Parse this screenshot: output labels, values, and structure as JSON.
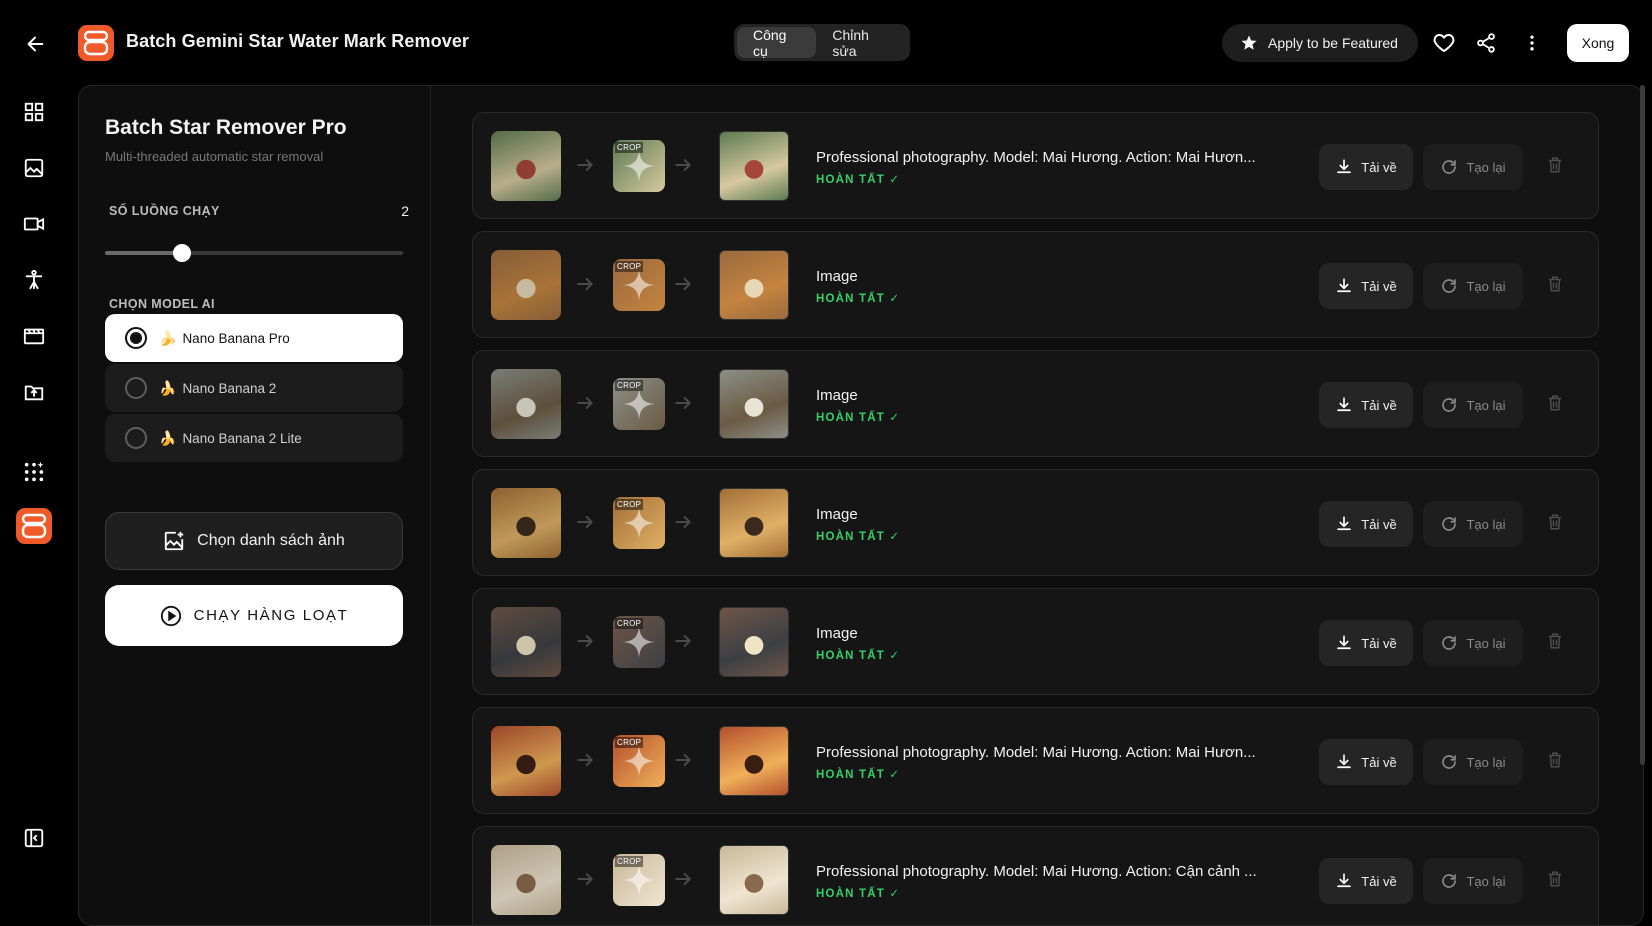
{
  "header": {
    "app_title": "Batch Gemini Star Water Mark Remover",
    "tabs": [
      {
        "label": "Công cụ",
        "active": true
      },
      {
        "label": "Chỉnh sửa",
        "active": false
      }
    ],
    "featured_label": "Apply to be Featured",
    "done_label": "Xong"
  },
  "rail": {
    "items": [
      "grid-icon",
      "image-icon",
      "video-icon",
      "person-icon",
      "film-icon",
      "upload-folder-icon",
      "sparkle-grid-icon",
      "app-logo-icon"
    ],
    "bottom": "sidebar-toggle-icon"
  },
  "panel": {
    "title": "Batch Star Remover Pro",
    "subtitle": "Multi-threaded automatic star removal",
    "threads_label": "SỐ LUỒNG CHẠY",
    "threads_value": "2",
    "threads_fraction": 0.26,
    "model_label": "CHỌN MODEL AI",
    "models": [
      {
        "label": "Nano Banana Pro",
        "selected": true
      },
      {
        "label": "Nano Banana 2",
        "selected": false
      },
      {
        "label": "Nano Banana 2 Lite",
        "selected": false
      }
    ],
    "pick_label": "Chọn danh sách ảnh",
    "run_label": "CHẠY HÀNG LOẠT"
  },
  "jobs": [
    {
      "title": "Professional photography. Model: Mai Hương. Action: Mai Hươn...",
      "status": "HOÀN TẤT ✓",
      "crop_tag": "CROP",
      "colors": [
        "#5d7b52",
        "#a6453a",
        "#d7c8a0"
      ]
    },
    {
      "title": "Image",
      "status": "HOÀN TẤT ✓",
      "crop_tag": "CROP",
      "colors": [
        "#9b6a3e",
        "#e8d7b5",
        "#c4843f"
      ]
    },
    {
      "title": "Image",
      "status": "HOÀN TẤT ✓",
      "crop_tag": "CROP",
      "colors": [
        "#8b8f86",
        "#e9e3d4",
        "#6b5a44"
      ]
    },
    {
      "title": "Image",
      "status": "HOÀN TẤT ✓",
      "crop_tag": "CROP",
      "colors": [
        "#a36f36",
        "#3b2a1c",
        "#e0b066"
      ]
    },
    {
      "title": "Image",
      "status": "HOÀN TẤT ✓",
      "crop_tag": "CROP",
      "colors": [
        "#6d5547",
        "#efe3c3",
        "#3d3f44"
      ]
    },
    {
      "title": "Professional photography. Model: Mai Hương. Action: Mai Hươn...",
      "status": "HOÀN TẤT ✓",
      "crop_tag": "CROP",
      "colors": [
        "#b4502c",
        "#3a1e14",
        "#f0b05a"
      ]
    },
    {
      "title": "Professional photography. Model: Mai Hương. Action: Cận cảnh ...",
      "status": "HOÀN TẤT ✓",
      "crop_tag": "CROP",
      "colors": [
        "#c9b89a",
        "#8a6a4c",
        "#efe5d0"
      ]
    }
  ],
  "job_actions": {
    "download_label": "Tải về",
    "regen_label": "Tạo lại"
  },
  "colors": {
    "accent": "#f05a28",
    "success": "#36d06a",
    "background": "#000000"
  }
}
